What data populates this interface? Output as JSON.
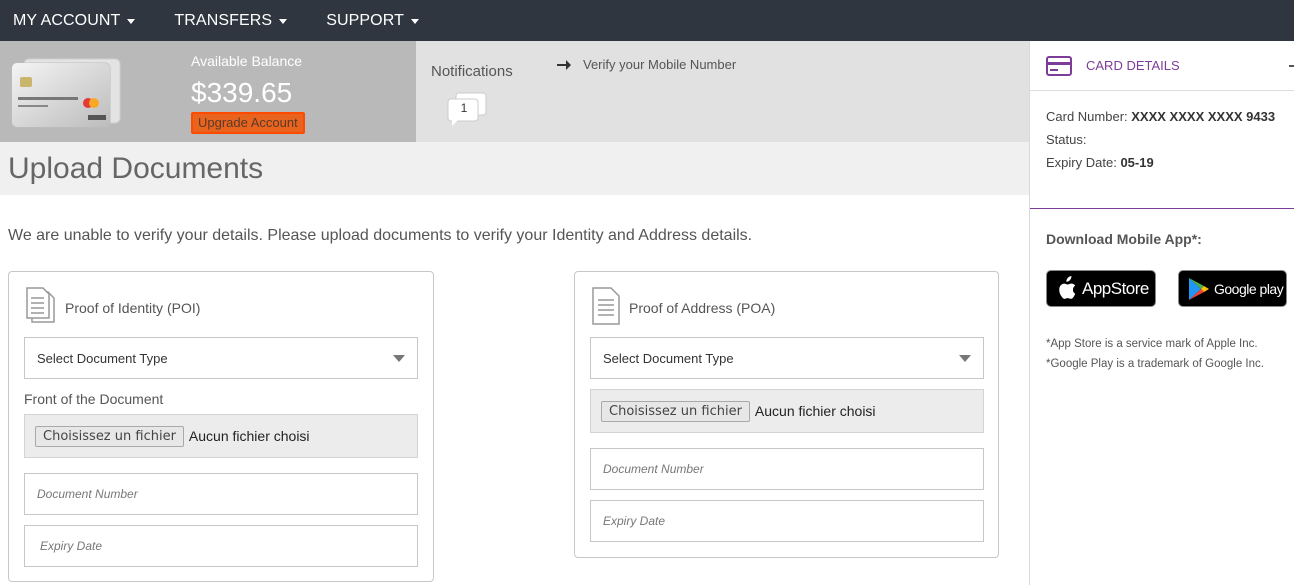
{
  "nav": {
    "items": [
      {
        "label": "MY ACCOUNT"
      },
      {
        "label": "TRANSFERS"
      },
      {
        "label": "SUPPORT"
      }
    ]
  },
  "balance": {
    "label": "Available Balance",
    "value": "$339.65",
    "upgrade_label": "Upgrade Account"
  },
  "notifications": {
    "label": "Notifications",
    "count": "1",
    "verify_label": "Verify your Mobile Number"
  },
  "page": {
    "title": "Upload Documents",
    "intro": "We are unable to verify your details. Please upload documents to verify your Identity and Address details."
  },
  "poi": {
    "title": "Proof of Identity (POI)",
    "select_label": "Select Document Type",
    "front_label": "Front of the Document",
    "file_button": "Choisissez un fichier",
    "file_status": "Aucun fichier choisi",
    "doc_number_placeholder": "Document Number",
    "expiry_placeholder": "Expiry Date"
  },
  "poa": {
    "title": "Proof of Address (POA)",
    "select_label": "Select Document Type",
    "file_button": "Choisissez un fichier",
    "file_status": "Aucun fichier choisi",
    "doc_number_placeholder": "Document Number",
    "expiry_placeholder": "Expiry Date"
  },
  "sidebar": {
    "card_details_title": "CARD DETAILS",
    "card_number_label": "Card Number:",
    "card_number_value": "XXXX XXXX XXXX 9433",
    "status_label": "Status:",
    "expiry_label": "Expiry Date:",
    "expiry_value": "05-19",
    "download_label": "Download Mobile App*:",
    "appstore_label": "AppStore",
    "googleplay_label": "Google play",
    "disclaimer_1": "*App Store is a service mark of Apple Inc.",
    "disclaimer_2": "*Google Play is a trademark of Google Inc."
  },
  "colors": {
    "nav_bg": "#2f3640",
    "accent_purple": "#7d3c98",
    "upgrade_orange": "#e8641e"
  }
}
